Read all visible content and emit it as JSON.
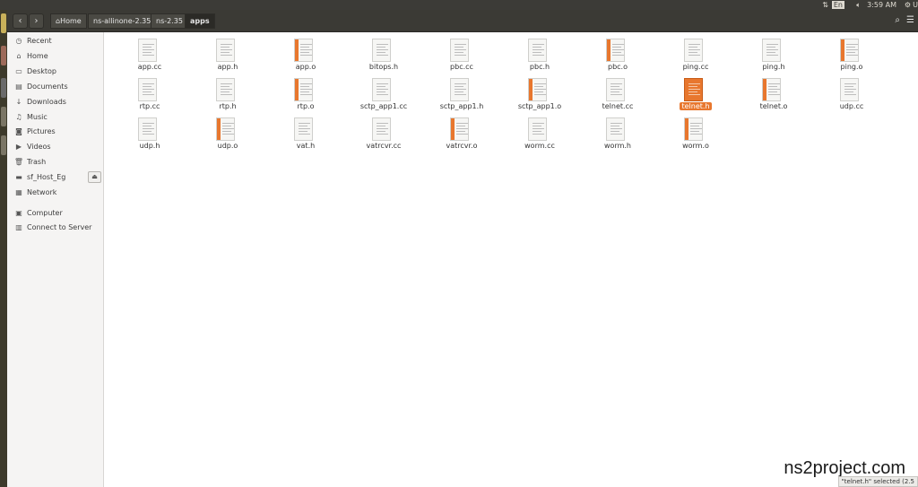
{
  "top_panel": {
    "keyboard": "En",
    "clock": "3:59 AM",
    "user": "U"
  },
  "toolbar": {
    "breadcrumbs": [
      {
        "label": "Home"
      },
      {
        "label": "ns-allinone-2.35"
      },
      {
        "label": "ns-2.35"
      },
      {
        "label": "apps"
      }
    ]
  },
  "sidebar": {
    "items": [
      {
        "label": "Recent",
        "icon": "clock-icon"
      },
      {
        "label": "Home",
        "icon": "home-icon"
      },
      {
        "label": "Desktop",
        "icon": "desktop-icon"
      },
      {
        "label": "Documents",
        "icon": "documents-icon"
      },
      {
        "label": "Downloads",
        "icon": "download-icon"
      },
      {
        "label": "Music",
        "icon": "music-icon"
      },
      {
        "label": "Pictures",
        "icon": "camera-icon"
      },
      {
        "label": "Videos",
        "icon": "video-icon"
      },
      {
        "label": "Trash",
        "icon": "trash-icon"
      },
      {
        "label": "sf_Host_Eg",
        "icon": "drive-icon"
      },
      {
        "label": "Network",
        "icon": "network-icon"
      },
      {
        "label": "Computer",
        "icon": "computer-icon"
      },
      {
        "label": "Connect to Server",
        "icon": "server-icon"
      }
    ]
  },
  "files": [
    {
      "name": "app.cc",
      "kind": "cpp"
    },
    {
      "name": "app.h",
      "kind": "header"
    },
    {
      "name": "app.o",
      "kind": "object"
    },
    {
      "name": "bitops.h",
      "kind": "header"
    },
    {
      "name": "pbc.cc",
      "kind": "cpp"
    },
    {
      "name": "pbc.h",
      "kind": "header"
    },
    {
      "name": "pbc.o",
      "kind": "object"
    },
    {
      "name": "ping.cc",
      "kind": "cpp"
    },
    {
      "name": "ping.h",
      "kind": "header"
    },
    {
      "name": "ping.o",
      "kind": "object"
    },
    {
      "name": "rtp.cc",
      "kind": "cpp"
    },
    {
      "name": "rtp.h",
      "kind": "header"
    },
    {
      "name": "rtp.o",
      "kind": "object"
    },
    {
      "name": "sctp_app1.cc",
      "kind": "cpp"
    },
    {
      "name": "sctp_app1.h",
      "kind": "header"
    },
    {
      "name": "sctp_app1.o",
      "kind": "object"
    },
    {
      "name": "telnet.cc",
      "kind": "cpp"
    },
    {
      "name": "telnet.h",
      "kind": "header",
      "selected": true
    },
    {
      "name": "telnet.o",
      "kind": "object"
    },
    {
      "name": "udp.cc",
      "kind": "cpp"
    },
    {
      "name": "udp.h",
      "kind": "header"
    },
    {
      "name": "udp.o",
      "kind": "object"
    },
    {
      "name": "vat.h",
      "kind": "header"
    },
    {
      "name": "vatrcvr.cc",
      "kind": "cpp"
    },
    {
      "name": "vatrcvr.o",
      "kind": "object"
    },
    {
      "name": "worm.cc",
      "kind": "cpp"
    },
    {
      "name": "worm.h",
      "kind": "header"
    },
    {
      "name": "worm.o",
      "kind": "object"
    }
  ],
  "status": "\"telnet.h\" selected  (2.5",
  "watermark": "ns2project.com",
  "colors": {
    "accent": "#e8772e",
    "toolbar": "#3b3a35",
    "panel": "#3c3b37"
  }
}
